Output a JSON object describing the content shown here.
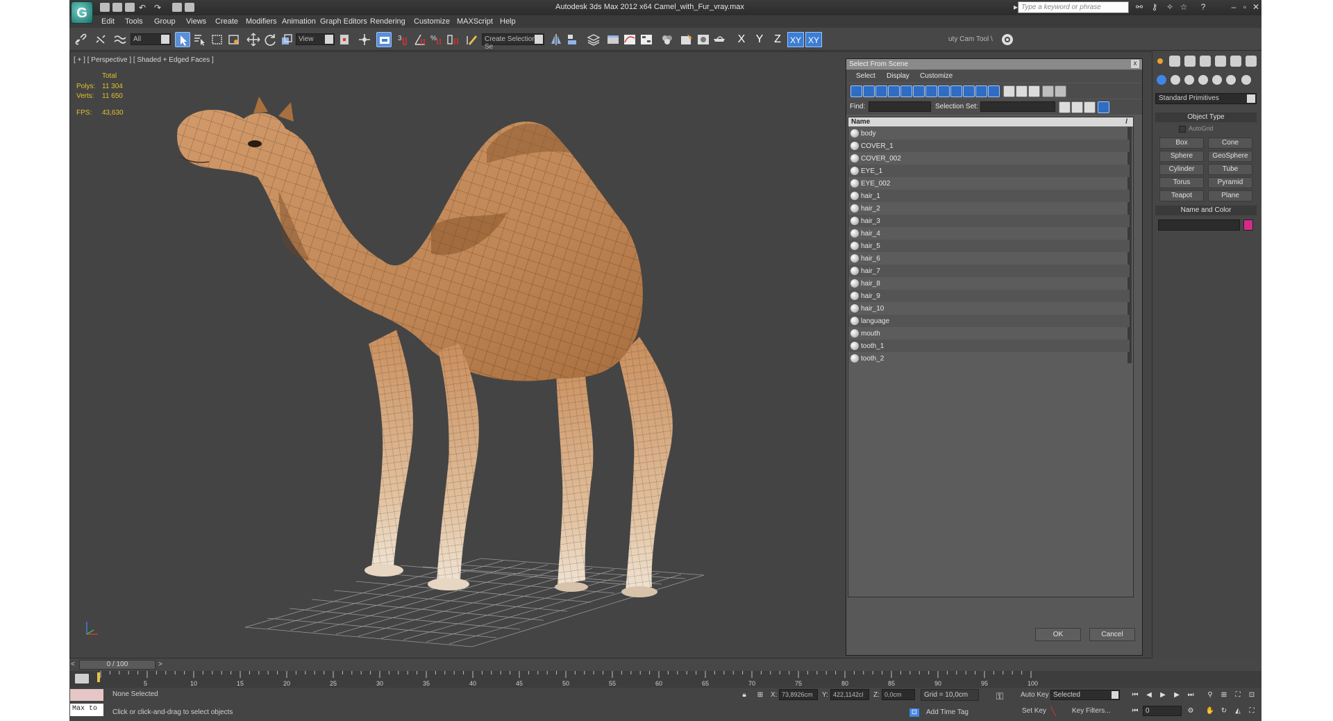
{
  "window": {
    "title": "Autodesk 3ds Max  2012 x64     Camel_with_Fur_vray.max",
    "search_placeholder": "Type a keyword or phrase",
    "logo_letter": "G"
  },
  "menu": [
    "Edit",
    "Tools",
    "Group",
    "Views",
    "Create",
    "Modifiers",
    "Animation",
    "Graph Editors",
    "Rendering",
    "Customize",
    "MAXScript",
    "Help"
  ],
  "toolbar": {
    "filter_value": "All",
    "ref_coord_value": "View",
    "named_selection_value": "Create Selection Se",
    "axes": [
      "X",
      "Y",
      "Z",
      "XY",
      "XY"
    ],
    "cam_tool_label": "uty Cam Tool \\"
  },
  "viewport": {
    "label": "[ + ] [ Perspective ] [ Shaded + Edged Faces ]",
    "stats_header": "Total",
    "polys_label": "Polys:",
    "polys_value": "11 304",
    "verts_label": "Verts:",
    "verts_value": "11 650",
    "fps_label": "FPS:",
    "fps_value": "43,630"
  },
  "dialog": {
    "title": "Select From Scene",
    "close_glyph": "x",
    "menu": [
      "Select",
      "Display",
      "Customize"
    ],
    "find_label": "Find:",
    "selection_set_label": "Selection Set:",
    "column_header": "Name",
    "sort_glyph": "/",
    "objects": [
      "body",
      "COVER_1",
      "COVER_002",
      "EYE_1",
      "EYE_002",
      "hair_1",
      "hair_2",
      "hair_3",
      "hair_4",
      "hair_5",
      "hair_6",
      "hair_7",
      "hair_8",
      "hair_9",
      "hair_10",
      "language",
      "mouth",
      "tooth_1",
      "tooth_2"
    ],
    "ok_label": "OK",
    "cancel_label": "Cancel"
  },
  "command_panel": {
    "category": "Standard Primitives",
    "object_type_title": "Object Type",
    "autogrid_label": "AutoGrid",
    "primitives": [
      "Box",
      "Cone",
      "Sphere",
      "GeoSphere",
      "Cylinder",
      "Tube",
      "Torus",
      "Pyramid",
      "Teapot",
      "Plane"
    ],
    "name_color_title": "Name and Color",
    "object_color": "#d62a8a"
  },
  "timeline": {
    "slider_label": "0 / 100",
    "ticks": [
      "5",
      "10",
      "15",
      "20",
      "25",
      "30",
      "35",
      "40",
      "45",
      "50",
      "55",
      "60",
      "65",
      "70",
      "75",
      "80",
      "85",
      "90",
      "95",
      "100"
    ]
  },
  "status": {
    "maxscript_text": "Max to",
    "selection_text": "None Selected",
    "prompt_text": "Click or click-and-drag to select objects",
    "x_label": "X:",
    "x_value": "73,8926cm",
    "y_label": "Y:",
    "y_value": "422,1142cl",
    "z_label": "Z:",
    "z_value": "0,0cm",
    "grid_text": "Grid = 10,0cm",
    "add_time_tag": "Add Time Tag",
    "auto_key": "Auto Key",
    "set_key": "Set Key",
    "key_mode_value": "Selected",
    "key_filters": "Key Filters...",
    "frame_value": "0"
  }
}
